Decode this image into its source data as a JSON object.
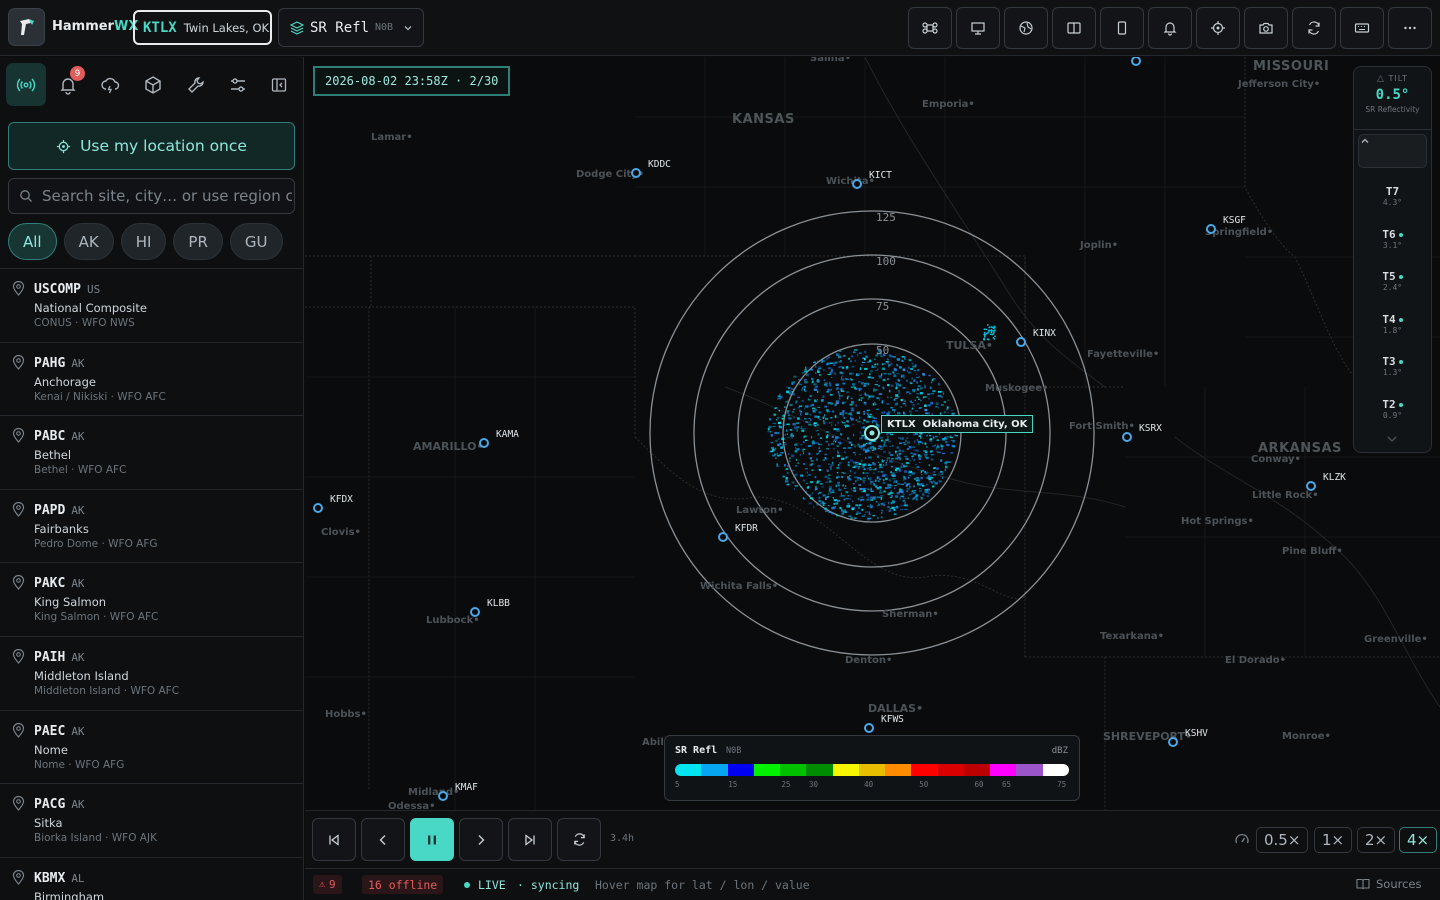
{
  "app": {
    "name_a": "Hammer",
    "name_b": "WX"
  },
  "site_chip": {
    "id": "KTLX",
    "city": "Twin Lakes, OK"
  },
  "product_chip": {
    "name": "SR Refl",
    "code": "N0B"
  },
  "toolbar_icons": [
    "command-icon",
    "presentation-icon",
    "globe-icon",
    "split-view-icon",
    "mobile-icon",
    "bell-icon",
    "crosshair-icon",
    "camera-icon",
    "refresh-icon",
    "keyboard-icon",
    "more-icon"
  ],
  "sidebar": {
    "alert_badge": "9",
    "location_button": "Use my location once",
    "search_placeholder": "Search site, city… or use region cl",
    "filters": [
      "All",
      "AK",
      "HI",
      "PR",
      "GU"
    ],
    "sites": [
      {
        "id": "USCOMP",
        "state": "US",
        "name": "National Composite",
        "sub": "CONUS · WFO NWS"
      },
      {
        "id": "PAHG",
        "state": "AK",
        "name": "Anchorage",
        "sub": "Kenai / Nikiski · WFO AFC"
      },
      {
        "id": "PABC",
        "state": "AK",
        "name": "Bethel",
        "sub": "Bethel · WFO AFC"
      },
      {
        "id": "PAPD",
        "state": "AK",
        "name": "Fairbanks",
        "sub": "Pedro Dome · WFO AFG"
      },
      {
        "id": "PAKC",
        "state": "AK",
        "name": "King Salmon",
        "sub": "King Salmon · WFO AFC"
      },
      {
        "id": "PAIH",
        "state": "AK",
        "name": "Middleton Island",
        "sub": "Middleton Island · WFO AFC"
      },
      {
        "id": "PAEC",
        "state": "AK",
        "name": "Nome",
        "sub": "Nome · WFO AFG"
      },
      {
        "id": "PACG",
        "state": "AK",
        "name": "Sitka",
        "sub": "Biorka Island · WFO AJK"
      },
      {
        "id": "KBMX",
        "state": "AL",
        "name": "Birmingham",
        "sub": ""
      }
    ]
  },
  "map": {
    "timestamp": "2026-08-02 23:58Z · 2/30",
    "active_site_label": "KTLX  Oklahoma City, OK",
    "range_rings": [
      "125",
      "100",
      "75",
      "50"
    ],
    "states": [
      "KANSAS",
      "MISSOURI",
      "ARKANSAS"
    ],
    "cities": [
      "Salina",
      "Emporia",
      "Jefferson City",
      "Lamar",
      "Dodge City",
      "Wichita",
      "Springfield",
      "Joplin",
      "Tulsa",
      "Muskogee",
      "Fayetteville",
      "Fort Smith",
      "Amarillo",
      "Conway",
      "Little Rock",
      "Hot Springs",
      "Clovis",
      "Lawton",
      "Pine Bluff",
      "Wichita Falls",
      "Lubbock",
      "Sherman",
      "Texarkana",
      "Greenville",
      "Denton",
      "El Dorado",
      "Dallas",
      "Hobbs",
      "Abilene",
      "Shreveport",
      "Monroe",
      "Midland",
      "Odessa"
    ],
    "radars": [
      "KDDC",
      "KICT",
      "KSGF",
      "KINX",
      "KAMA",
      "KSRX",
      "KLZK",
      "KFDX",
      "KFDR",
      "KLBB",
      "KFWS",
      "KSHV",
      "KMAF"
    ],
    "tilt": {
      "title": "TILT",
      "value": "0.5°",
      "product": "SR Reflectivity",
      "items": [
        {
          "t": "T7",
          "a": "4.3°"
        },
        {
          "t": "T6",
          "a": "3.1°"
        },
        {
          "t": "T5",
          "a": "2.4°"
        },
        {
          "t": "T4",
          "a": "1.8°"
        },
        {
          "t": "T3",
          "a": "1.3°"
        },
        {
          "t": "T2",
          "a": "0.9°"
        }
      ]
    },
    "legend": {
      "title": "SR Refl",
      "code": "N0B",
      "unit": "dBZ",
      "ticks": [
        "5",
        "15",
        "25",
        "30",
        "40",
        "50",
        "60",
        "65",
        "75"
      ],
      "colors": [
        "#00e5f0",
        "#06a6f2",
        "#0000f0",
        "#00f000",
        "#00c000",
        "#008c00",
        "#f6f600",
        "#e8be00",
        "#ff8c00",
        "#ff0000",
        "#d80000",
        "#bc0000",
        "#ff00ff",
        "#9a55c9",
        "#ffffff"
      ]
    }
  },
  "playback": {
    "duration": "3.4h",
    "speeds": [
      "0.5×",
      "1×",
      "2×",
      "4×"
    ]
  },
  "status": {
    "warnings": "9",
    "offline": "16 offline",
    "live": "LIVE",
    "syncing": "· syncing",
    "hover_hint": "Hover map for lat / lon / value",
    "sources": "Sources"
  }
}
